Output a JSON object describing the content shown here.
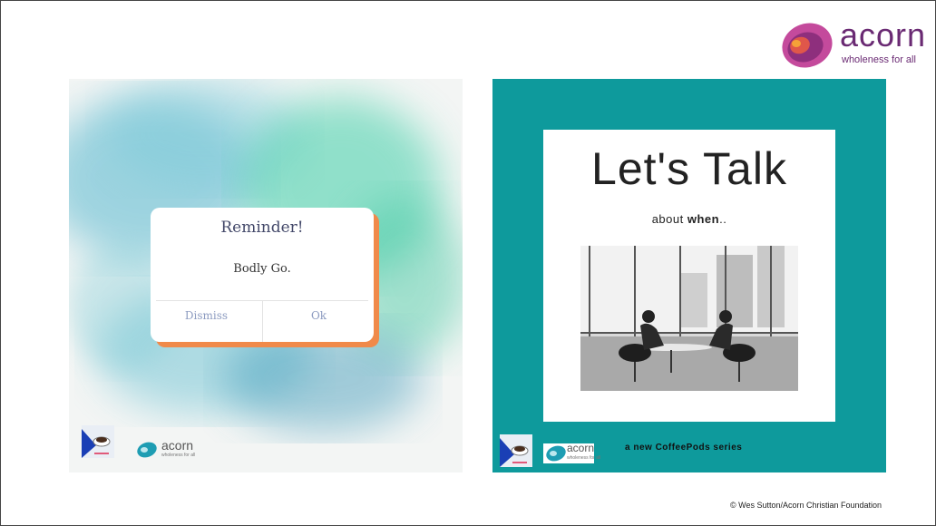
{
  "brand": {
    "name": "acorn",
    "tagline": "wholeness for all"
  },
  "left_panel": {
    "dialog": {
      "title": "Reminder!",
      "message": "Bodly Go.",
      "dismiss_label": "Dismiss",
      "ok_label": "Ok"
    },
    "footer_logo_word": "acorn",
    "footer_logo_tagline": "wholeness for all"
  },
  "right_panel": {
    "title": "Let's Talk",
    "subtitle_prefix": "about ",
    "subtitle_bold": "when",
    "subtitle_suffix": "..",
    "footer_logo_word": "acorn",
    "footer_logo_tagline": "wholeness for all",
    "series_label": "a new CoffeePods series"
  },
  "copyright": "© Wes Sutton/Acorn Christian Foundation",
  "colors": {
    "teal": "#0e9a9c",
    "orange_shadow": "#f08a4a",
    "brand_purple": "#6a2a73"
  }
}
